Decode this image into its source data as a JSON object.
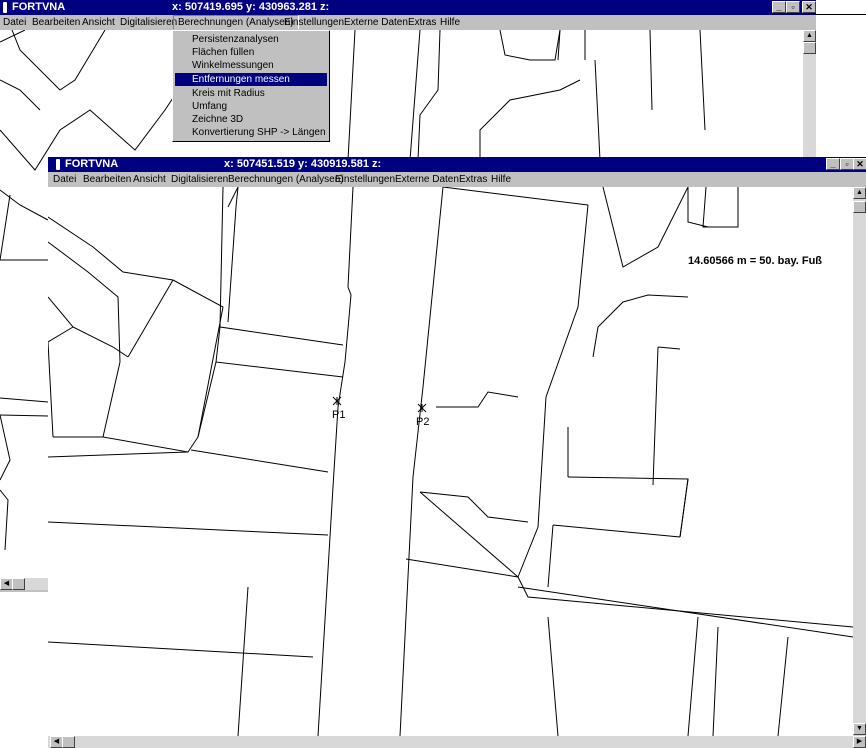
{
  "back_window": {
    "title": "FORTVNA",
    "coords": "x: 507419.695 y: 430963.281 z:",
    "menu": [
      "Datei",
      "Bearbeiten",
      "Ansicht",
      "Digitalisieren",
      "Berechnungen (Analysen)",
      "Einstellungen",
      "Externe Daten",
      "Extras",
      "Hilfe"
    ],
    "dropdown": [
      "Persistenzanalysen",
      "Flächen füllen",
      "Winkelmessungen",
      "Entfernungen messen",
      "Kreis mit Radius",
      "Umfang",
      "Zeichne 3D",
      "Konvertierung SHP -> Längen"
    ],
    "selected_item": "Entfernungen messen"
  },
  "front_window": {
    "title": "FORTVNA",
    "coords": "x: 507451.519 y: 430919.581 z:",
    "menu": [
      "Datei",
      "Bearbeiten",
      "Ansicht",
      "Digitalisieren",
      "Berechnungen (Analysen)",
      "Einstellungen",
      "Externe Daten",
      "Extras",
      "Hilfe"
    ],
    "measurement": "14.60566 m = 50. bay. Fuß",
    "points": [
      "P1",
      "P2"
    ]
  },
  "controls": {
    "minimize": "_",
    "maximize": "▫",
    "close": "✕"
  },
  "colors": {
    "titlebar": "#000080",
    "chrome": "#c0c0c0",
    "map_bg": "#ffffff",
    "lines": "#000000"
  }
}
